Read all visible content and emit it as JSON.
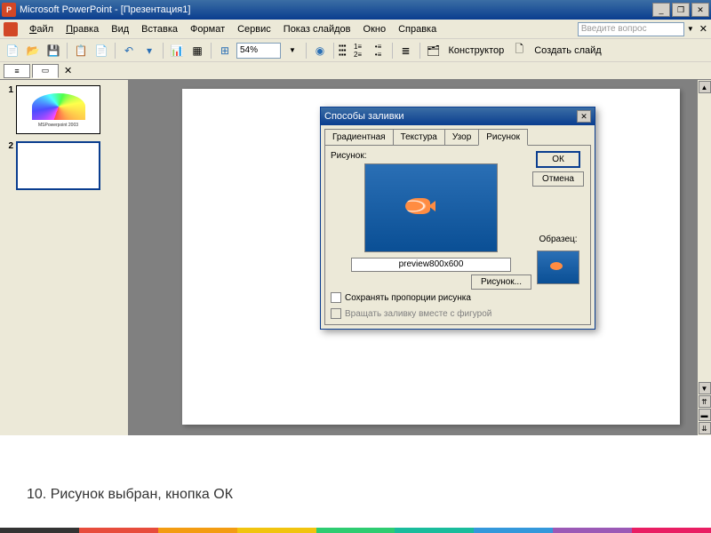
{
  "titlebar": {
    "app_icon": "P",
    "title": "Microsoft PowerPoint - [Презентация1]"
  },
  "menu": {
    "file": "Файл",
    "edit": "Правка",
    "view": "Вид",
    "insert": "Вставка",
    "format": "Формат",
    "service": "Сервис",
    "slideshow": "Показ слайдов",
    "window": "Окно",
    "help": "Справка",
    "help_placeholder": "Введите вопрос"
  },
  "toolbar": {
    "zoom": "54%",
    "designer": "Конструктор",
    "new_slide": "Создать слайд"
  },
  "slides": [
    {
      "num": "1",
      "label": "MSPowerpoint 2003"
    },
    {
      "num": "2",
      "label": ""
    }
  ],
  "dialog": {
    "title": "Способы заливки",
    "tabs": {
      "gradient": "Градиентная",
      "texture": "Текстура",
      "pattern": "Узор",
      "picture": "Рисунок"
    },
    "picture_label": "Рисунок:",
    "preview_caption": "preview800x600",
    "picture_button": "Рисунок...",
    "ok": "ОК",
    "cancel": "Отмена",
    "sample": "Образец:",
    "preserve_aspect": "Сохранять пропорции рисунка",
    "rotate_fill": "Вращать заливку вместе с фигурой"
  },
  "caption": "10.   Рисунок выбран, кнопка ОК",
  "colorbar": [
    "#333333",
    "#e74c3c",
    "#f39c12",
    "#f1c40f",
    "#2ecc71",
    "#1abc9c",
    "#3498db",
    "#9b59b6",
    "#e91e63"
  ]
}
